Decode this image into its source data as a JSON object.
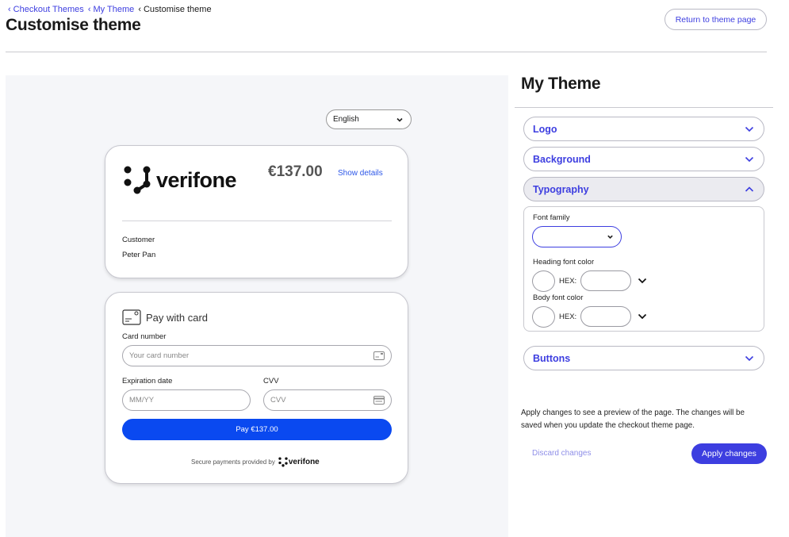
{
  "breadcrumb": {
    "items": [
      "Checkout Themes",
      "My Theme",
      "Customise theme"
    ],
    "separator": "‹"
  },
  "page_title": "Customise theme",
  "return_button": "Return to theme page",
  "preview": {
    "language": "English",
    "brand": "verifone",
    "amount": "€137.00",
    "show_details": "Show details",
    "customer_label": "Customer",
    "customer_name": "Peter Pan",
    "pay_with_card": "Pay with card",
    "card_number_label": "Card number",
    "card_number_placeholder": "Your card number",
    "expiry_label": "Expiration date",
    "expiry_placeholder": "MM/YY",
    "cvv_label": "CVV",
    "cvv_placeholder": "CVV",
    "pay_button": "Pay €137.00",
    "secure_text": "Secure payments provided by",
    "secure_brand": "verifone"
  },
  "panel": {
    "title": "My Theme",
    "sections": {
      "logo": "Logo",
      "background": "Background",
      "typography": "Typography",
      "buttons": "Buttons"
    },
    "typography": {
      "font_family_label": "Font family",
      "font_family_value": "",
      "heading_color_label": "Heading font color",
      "body_color_label": "Body font color",
      "hex_label": "HEX:",
      "heading_hex": "",
      "body_hex": ""
    },
    "info_text": "Apply changes to see a preview of the page. The changes will be saved when you update the checkout theme page.",
    "discard": "Discard changes",
    "apply": "Apply changes"
  },
  "colors": {
    "accent": "#3d3ee0",
    "pay_button": "#0a49f0",
    "preview_bg": "#f5f6f9"
  },
  "icons": [
    "chevron-left-icon",
    "chevron-down-icon",
    "chevron-up-icon",
    "card-icon",
    "verifone-logo"
  ]
}
